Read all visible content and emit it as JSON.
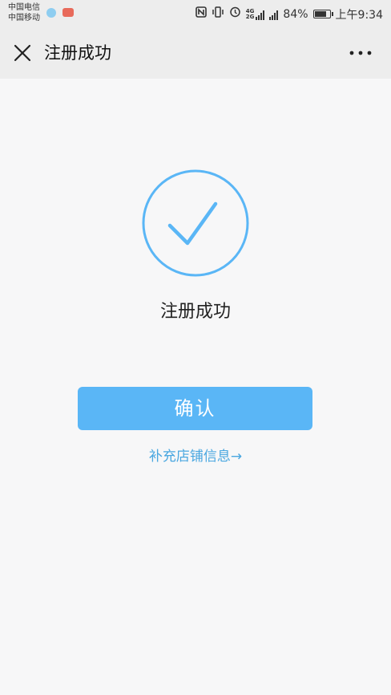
{
  "status_bar": {
    "carrier_1": "中国电信",
    "carrier_2": "中国移动",
    "network_label_1": "4G",
    "network_label_2": "2G",
    "battery_percent": "84%",
    "battery_level": 0.84,
    "time": "上午9:34",
    "icons": [
      "nfc-icon",
      "vibrate-icon",
      "alarm-icon",
      "signal-icon",
      "battery-icon"
    ]
  },
  "navbar": {
    "title": "注册成功",
    "close_icon": "close-icon",
    "more_icon": "more-icon"
  },
  "main": {
    "success_icon": "check-circle-icon",
    "success_message": "注册成功",
    "confirm_label": "确认",
    "supplement_link": "补充店铺信息→"
  },
  "colors": {
    "accent": "#5ab6f6",
    "link": "#4aa7e0",
    "header_bg": "#ededed",
    "page_bg": "#f7f7f8"
  }
}
